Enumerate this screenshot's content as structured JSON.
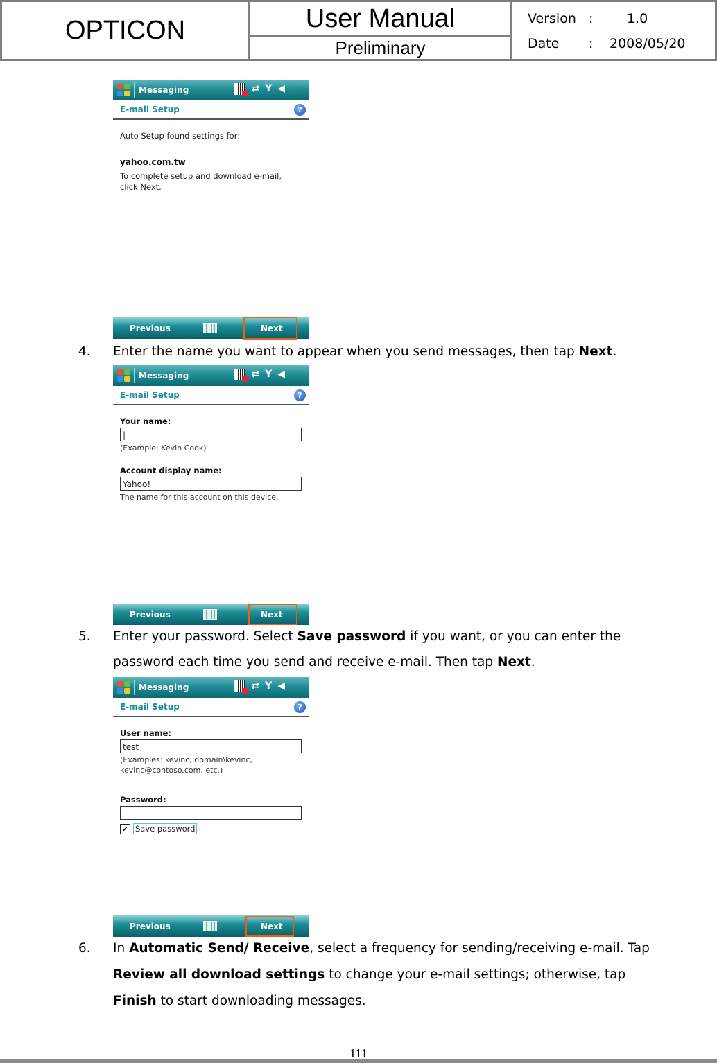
{
  "header": {
    "company": "OPTICON",
    "doc_title": "User Manual",
    "status": "Preliminary",
    "version_label": "Version",
    "version_sep": ":",
    "version_value": "1.0",
    "date_label": "Date",
    "date_sep": ":",
    "date_value": "2008/05/20"
  },
  "device": {
    "app_title": "Messaging",
    "subtitle": "E-mail Setup",
    "help_glyph": "?",
    "status_icons": [
      "barcode-icon",
      "connectivity-icon",
      "signal-icon",
      "speaker-icon"
    ],
    "softkey_left": "Previous",
    "softkey_right": "Next",
    "highlight_color": "#e8620f"
  },
  "screen1": {
    "line1": "Auto Setup found settings for:",
    "domain": "yahoo.com.tw",
    "instruction": "To complete setup and download e-mail, click Next."
  },
  "screen2": {
    "your_name_label": "Your name:",
    "your_name_value": "|",
    "your_name_note": "(Example: Kevin Cook)",
    "display_name_label": "Account display name:",
    "display_name_value": "Yahoo!",
    "display_name_note": "The name for this account on this device."
  },
  "screen3": {
    "user_name_label": "User name:",
    "user_name_value": "test",
    "user_name_note1": "(Examples: kevinc, domain\\kevinc,",
    "user_name_note2": "kevinc@contoso.com, etc.)",
    "password_label": "Password:",
    "password_value": "",
    "save_password_label": "Save password",
    "save_password_checked": "✔"
  },
  "steps": [
    {
      "num": "4.",
      "pre": "Enter the name you want to appear when you send messages, then tap ",
      "bold": "Next",
      "post": "."
    },
    {
      "num": "5.",
      "line1_pre": "Enter your password. Select ",
      "line1_bold": "Save password",
      "line1_post": " if you want, or you can enter the",
      "line2_pre": "password each time you send and receive e-mail. Then tap ",
      "line2_bold": "Next",
      "line2_post": "."
    },
    {
      "num": "6.",
      "line1_pre": "In ",
      "line1_bold": "Automatic Send/ Receive",
      "line1_post": ", select a frequency for sending/receiving e-mail. Tap",
      "line2_bold": "Review all download settings",
      "line2_post": " to change your e-mail settings; otherwise, tap",
      "line3_bold": "Finish",
      "line3_post": " to start downloading messages."
    }
  ],
  "footer": {
    "page_number": "111"
  }
}
